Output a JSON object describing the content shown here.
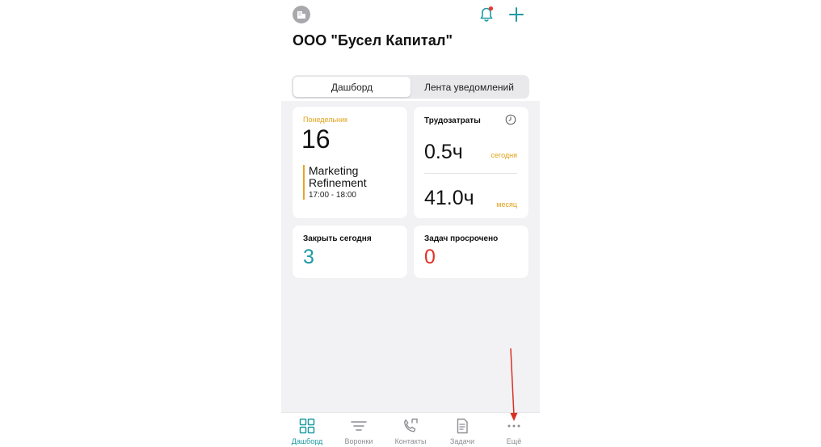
{
  "header": {
    "company_title": "ООО \"Бусел Капитал\"",
    "org_icon": "building-icon",
    "bell_icon": "bell-icon",
    "add_icon": "plus-icon",
    "notification_dot_color": "#e53935"
  },
  "segments": {
    "dashboard": "Дашборд",
    "feed": "Лента уведомлений"
  },
  "calendar_card": {
    "weekday": "Понедельник",
    "day": "16",
    "event_title": "Marketing Refinement",
    "event_time": "17:00 - 18:00"
  },
  "time_card": {
    "title": "Трудозатраты",
    "clock_icon": "clock-icon",
    "today_value": "0.5ч",
    "today_label": "сегодня",
    "month_value": "41.0ч",
    "month_label": "месяц"
  },
  "close_today_card": {
    "title": "Закрыть сегодня",
    "value": "3"
  },
  "overdue_card": {
    "title": "Задач просрочено",
    "value": "0"
  },
  "tabbar": {
    "dashboard": "Дашборд",
    "funnels": "Воронки",
    "contacts": "Контакты",
    "tasks": "Задачи",
    "more": "Ещё"
  },
  "colors": {
    "accent_teal": "#1e9aa4",
    "accent_orange": "#e0a21a",
    "danger_red": "#e03327",
    "annotation_arrow": "#d93025"
  }
}
